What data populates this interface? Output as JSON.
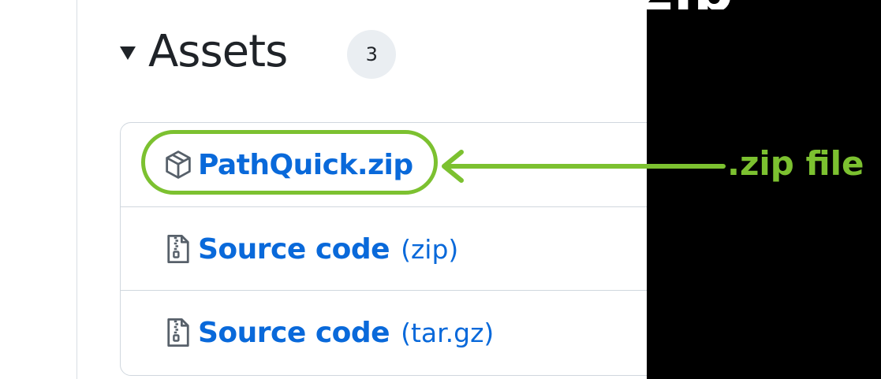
{
  "assets": {
    "heading": "Assets",
    "count": "3",
    "items": [
      {
        "name": "PathQuick.zip",
        "suffix": "",
        "icon": "package-icon"
      },
      {
        "name": "Source code",
        "suffix": "(zip)",
        "icon": "file-zip-icon"
      },
      {
        "name": "Source code",
        "suffix": "(tar.gz)",
        "icon": "file-zip-icon"
      }
    ]
  },
  "annotation": {
    "label": ".zip file",
    "color": "#7cc130"
  },
  "colors": {
    "link": "#0969da",
    "text": "#1f2328",
    "badge_bg": "#eaeef2",
    "border": "#d0d7de",
    "backdrop": "#000000"
  }
}
